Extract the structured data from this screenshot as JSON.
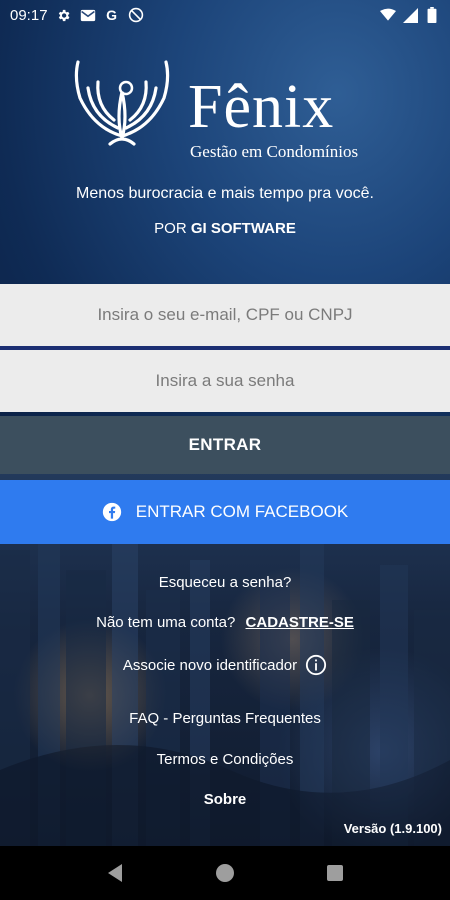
{
  "status_bar": {
    "time": "09:17",
    "left_icons": [
      "gear-icon",
      "gmail-icon",
      "google-icon",
      "do-not-disturb-icon"
    ],
    "right_icons": [
      "wifi-icon",
      "signal-icon",
      "battery-icon"
    ]
  },
  "header": {
    "brand_name": "Fênix",
    "brand_subtitle": "Gestão em Condomínios",
    "tagline": "Menos burocracia e mais tempo pra você.",
    "byline_prefix": "POR",
    "byline_company": "GI SOFTWARE"
  },
  "login": {
    "email_placeholder": "Insira o seu e-mail, CPF ou CNPJ",
    "email_value": "",
    "password_placeholder": "Insira a sua senha",
    "password_value": "",
    "enter_label": "ENTRAR",
    "facebook_label": "ENTRAR COM FACEBOOK"
  },
  "links": {
    "forgot_password": "Esqueceu a senha?",
    "no_account": "Não tem uma conta?",
    "signup": "CADASTRE-SE",
    "associate_identifier": "Associe novo identificador",
    "faq": "FAQ - Perguntas Frequentes",
    "terms": "Termos e Condições",
    "about": "Sobre"
  },
  "version": "Versão (1.9.100)",
  "colors": {
    "input_bg": "#ececec",
    "enter_button": "#3c4f5e",
    "facebook_button": "#2f7bef",
    "divider": "#1b2e72"
  },
  "nav_bar": {
    "buttons": [
      "back-icon",
      "home-icon",
      "recents-icon"
    ]
  }
}
